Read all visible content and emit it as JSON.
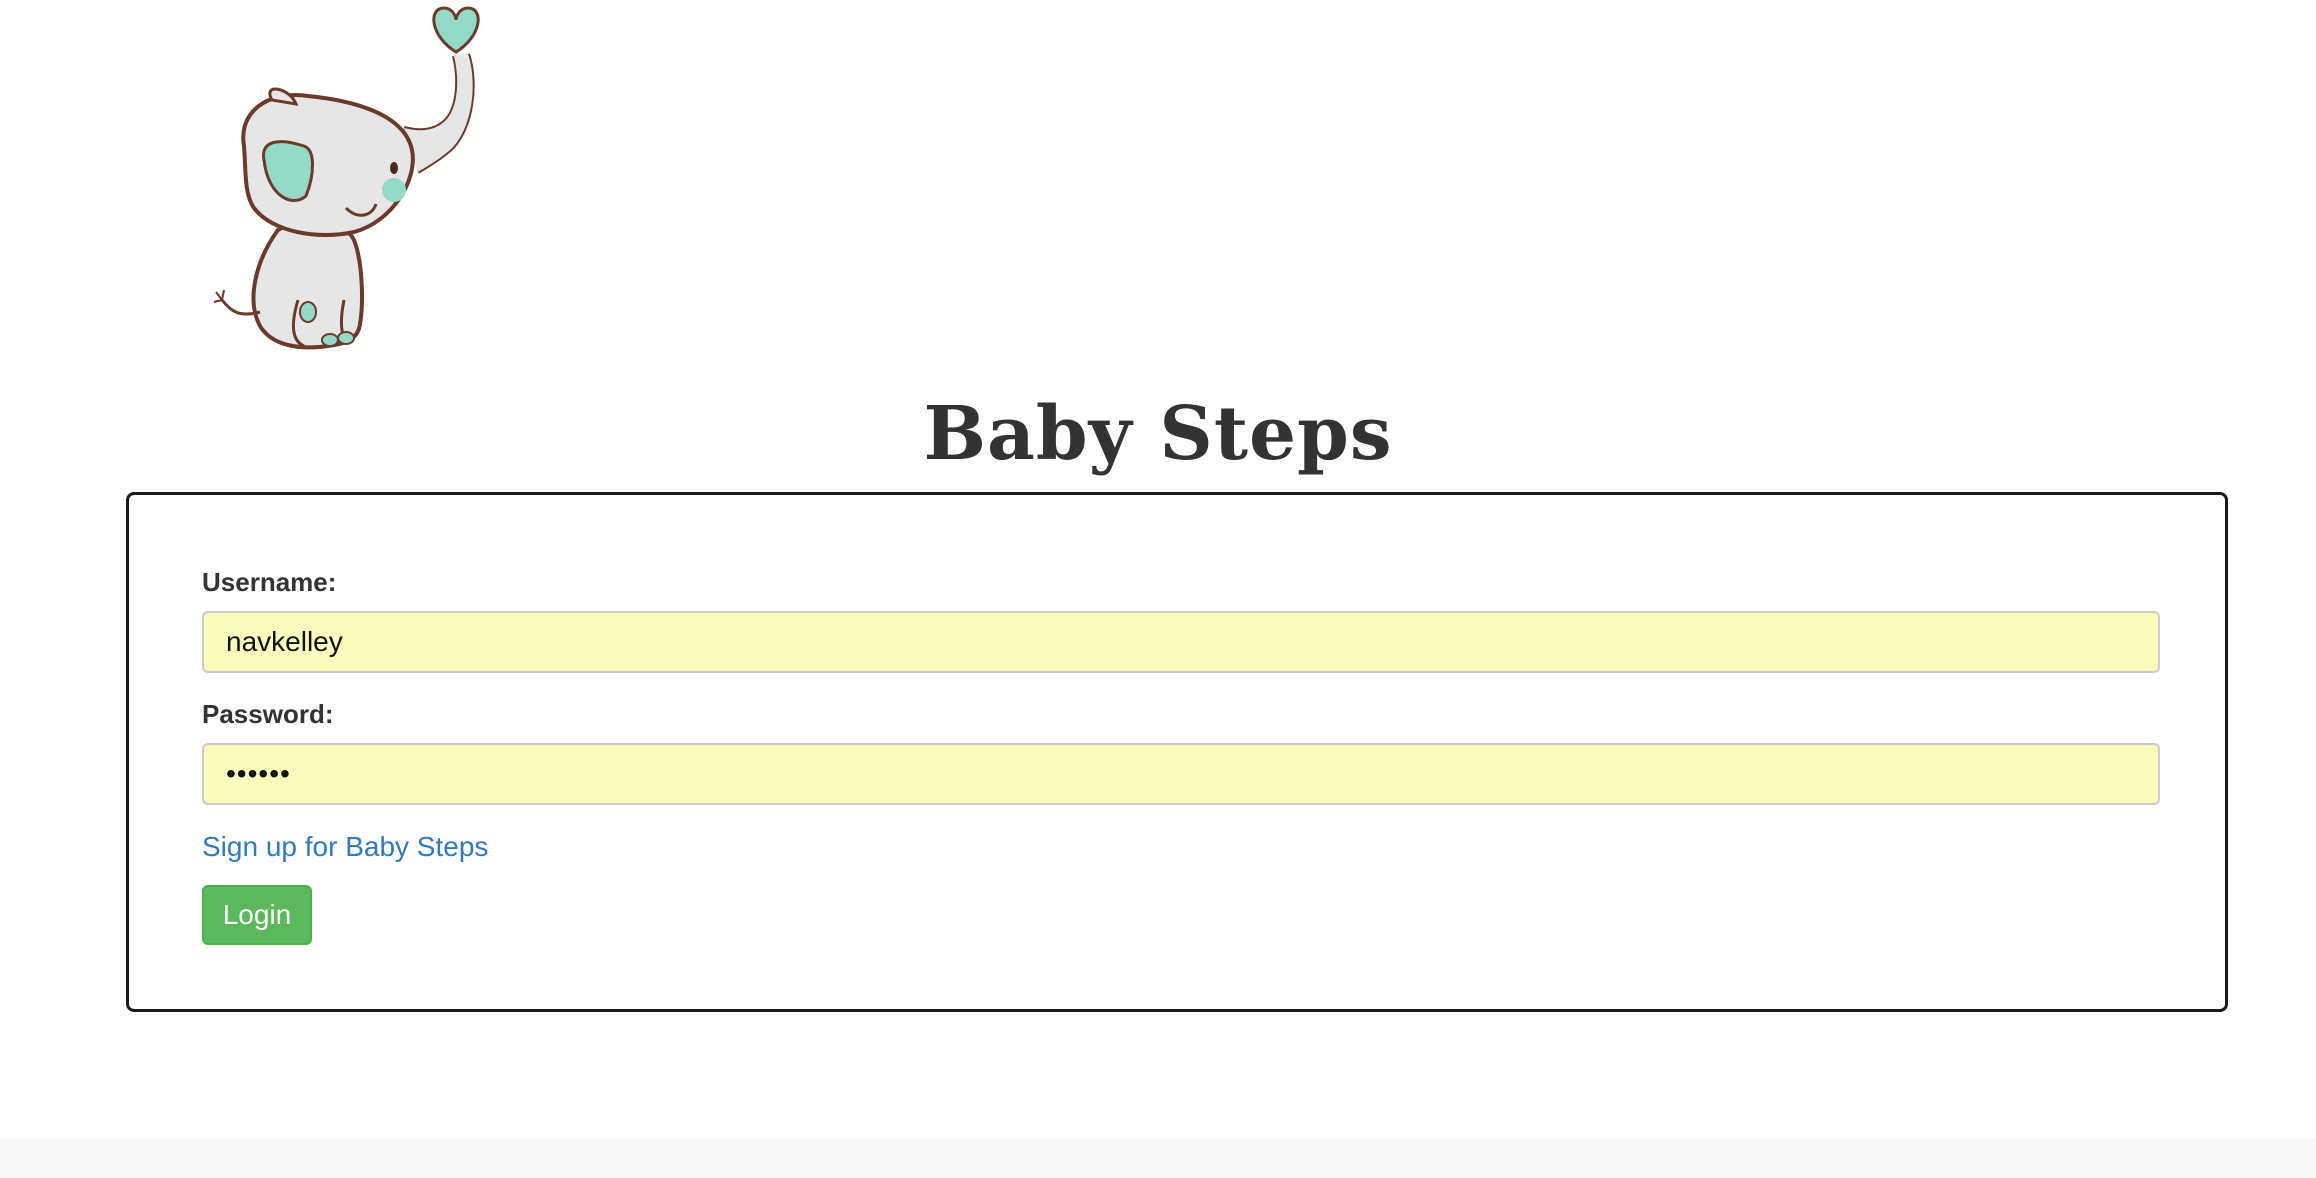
{
  "header": {
    "logo_icon": "baby-elephant-heart-icon",
    "title": "Baby Steps"
  },
  "login_form": {
    "username_label": "Username:",
    "username_value": "navkelley",
    "password_label": "Password:",
    "password_value": "••••••",
    "signup_link": "Sign up for Baby Steps",
    "login_button": "Login"
  },
  "colors": {
    "input_autofill_bg": "#fafcbd",
    "link": "#337ab7",
    "login_button": "#5cb85c",
    "elephant_accent": "#94dac7"
  }
}
